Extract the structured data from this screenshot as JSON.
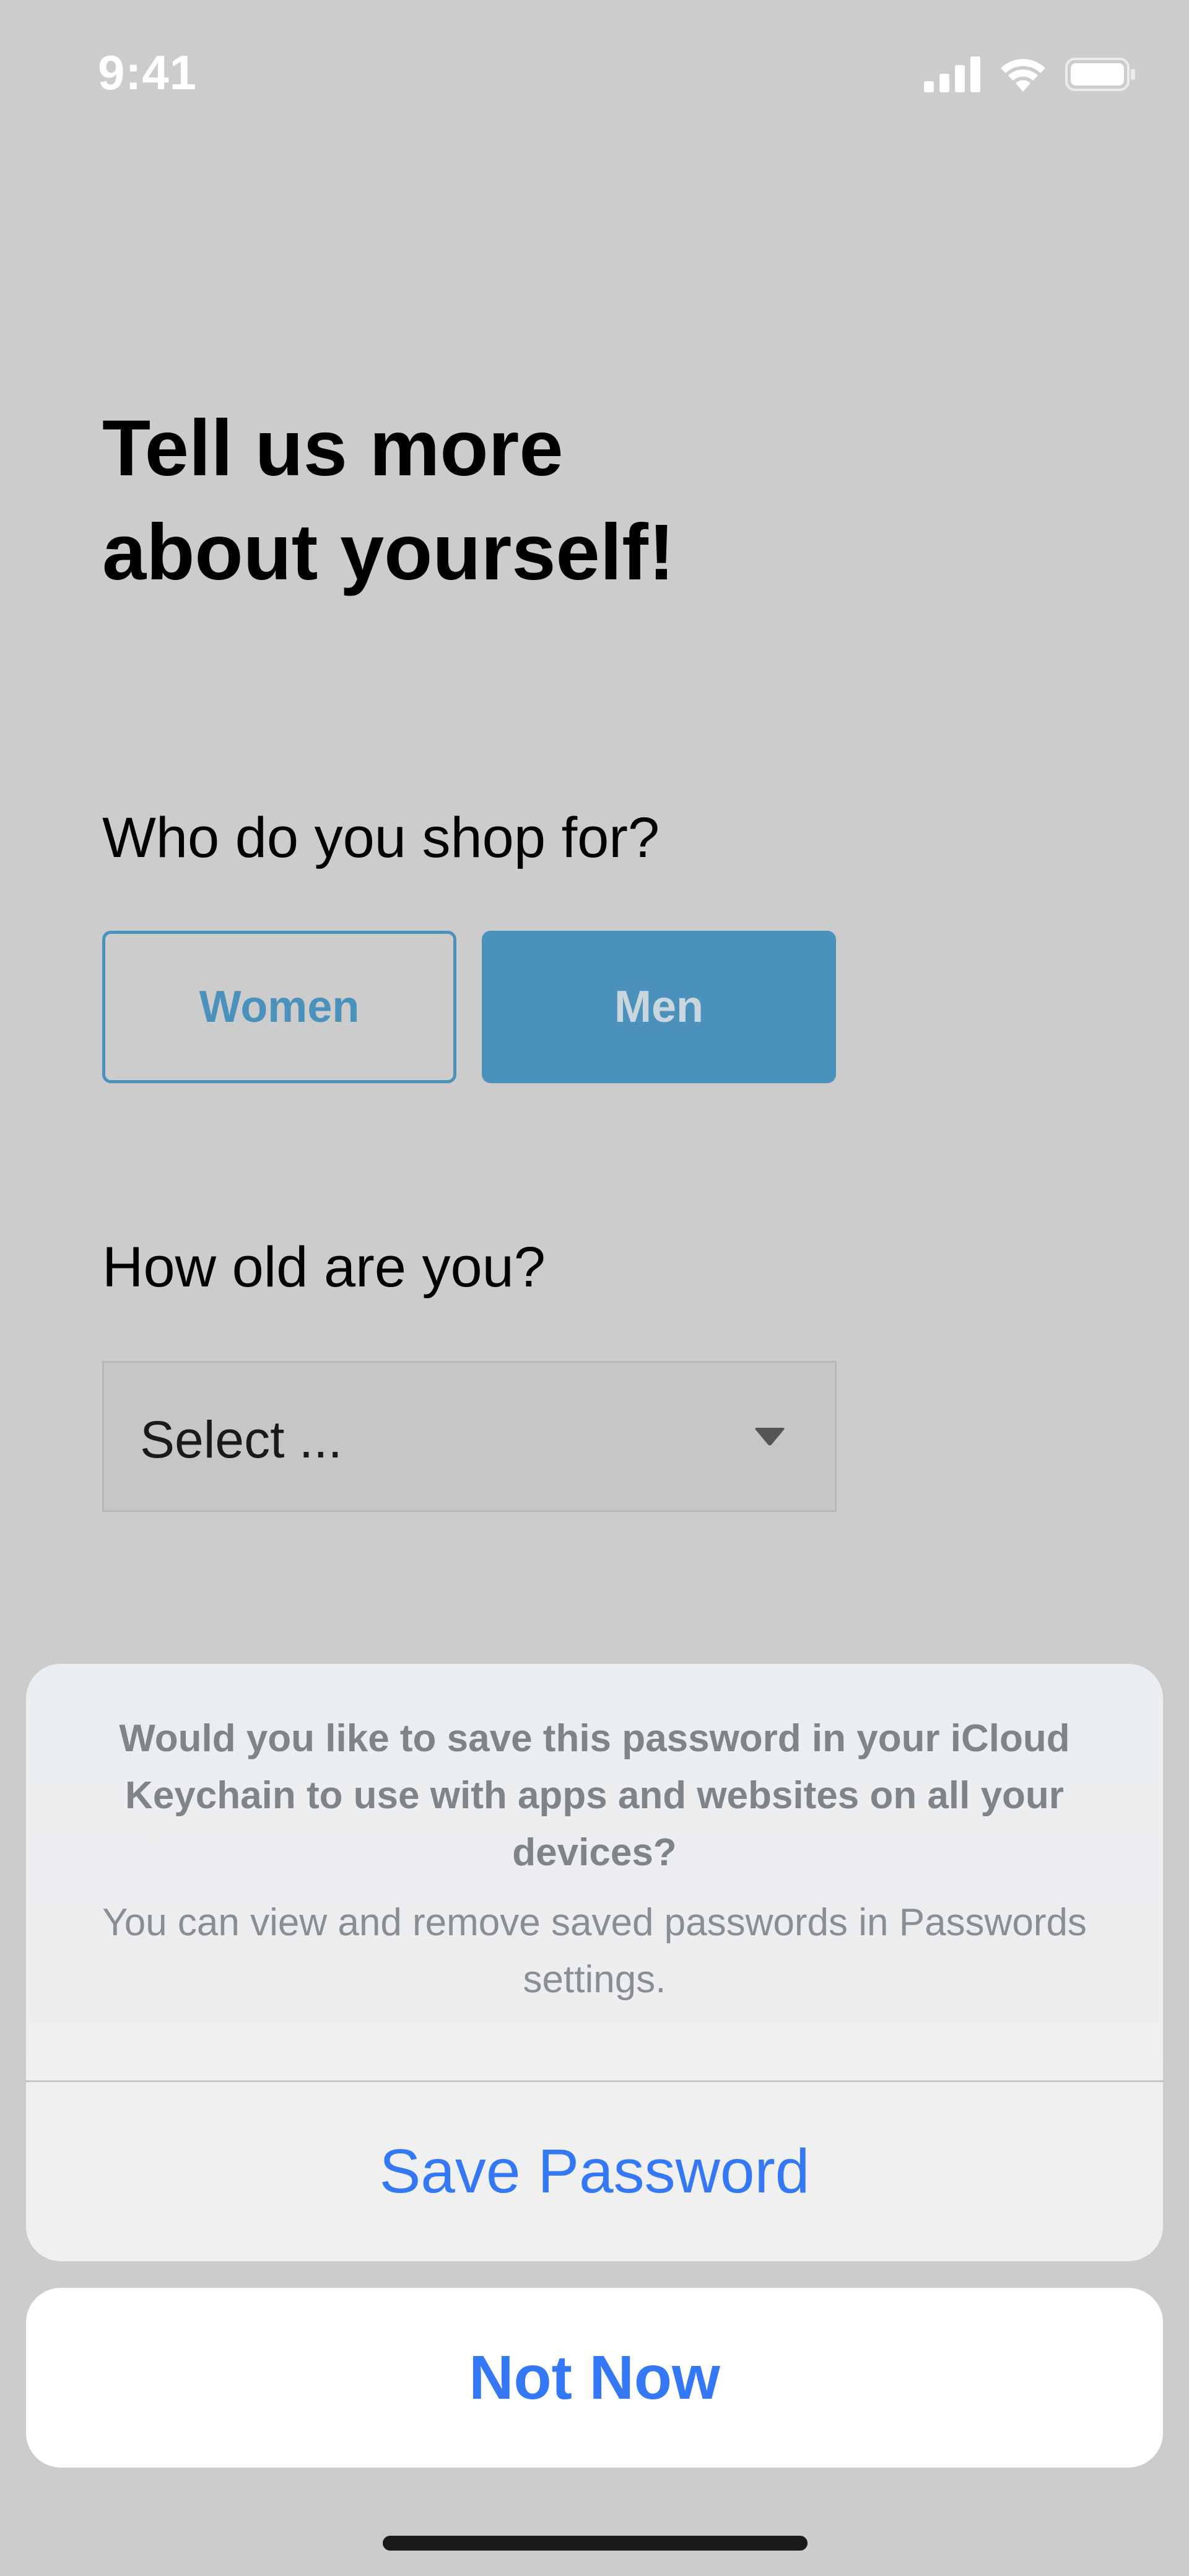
{
  "status_bar": {
    "time": "9:41",
    "icons": [
      "signal-icon",
      "wifi-icon",
      "battery-icon"
    ]
  },
  "page": {
    "title_line1": "Tell us more",
    "title_line2": "about yourself!",
    "shop_question": "Who do you shop for?",
    "shop_options": [
      {
        "label": "Women",
        "selected": false
      },
      {
        "label": "Men",
        "selected": true
      }
    ],
    "age_question": "How old are you?",
    "age_select": {
      "value": "Select ...",
      "icon": "chevron-down-icon"
    }
  },
  "action_sheet": {
    "title": "Would you like to save this password in your iCloud Keychain to use with apps and websites on all your devices?",
    "message": "You can view and remove saved passwords in Passwords settings.",
    "save_label": "Save Password",
    "cancel_label": "Not Now"
  },
  "colors": {
    "background": "#cccccc",
    "accent": "#4a91bb",
    "ios_blue": "#3478f6"
  }
}
